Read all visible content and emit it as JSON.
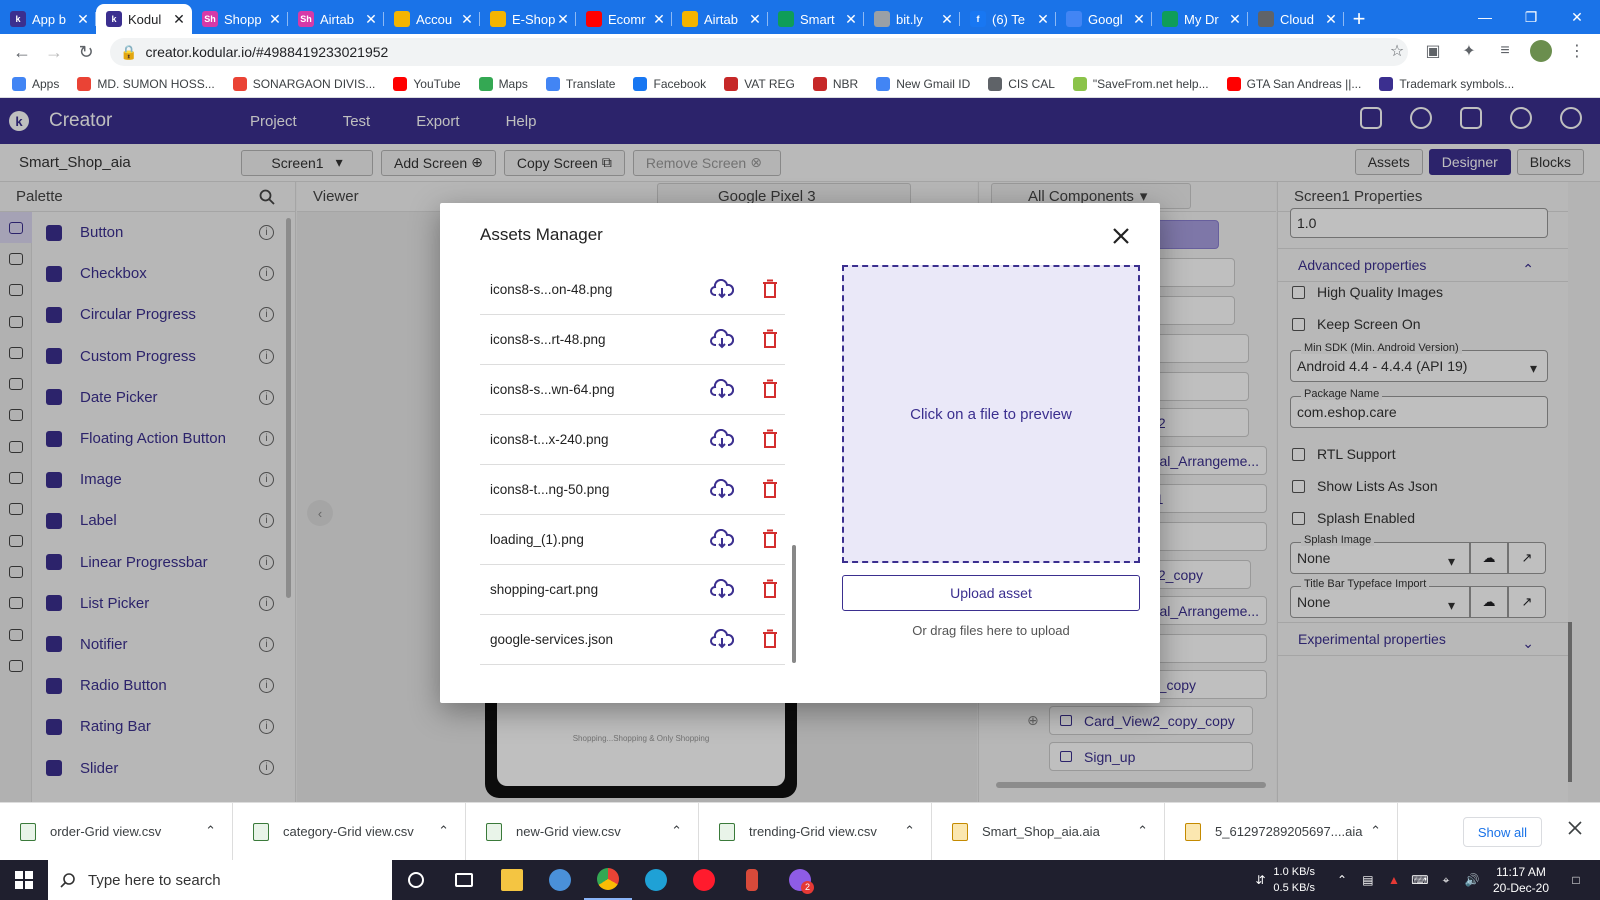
{
  "browser": {
    "tabs": [
      {
        "label": "App b",
        "color": "#3b2f8f",
        "glyph": "k"
      },
      {
        "label": "Kodul",
        "color": "#3b2f8f",
        "glyph": "k",
        "active": true
      },
      {
        "label": "Shopp",
        "color": "#d63aa8",
        "glyph": "Sh"
      },
      {
        "label": "Airtab",
        "color": "#d63aa8",
        "glyph": "Sh"
      },
      {
        "label": "Accou",
        "color": "#f4b400",
        "glyph": ""
      },
      {
        "label": "E-Shop",
        "color": "#f4b400",
        "glyph": ""
      },
      {
        "label": "Ecomr",
        "color": "#ff0000",
        "glyph": ""
      },
      {
        "label": "Airtab",
        "color": "#f4b400",
        "glyph": ""
      },
      {
        "label": "Smart",
        "color": "#0f9d58",
        "glyph": ""
      },
      {
        "label": "bit.ly",
        "color": "#9aa0a6",
        "glyph": ""
      },
      {
        "label": "(6) Te",
        "color": "#1877f2",
        "glyph": "f"
      },
      {
        "label": "Googl",
        "color": "#4285f4",
        "glyph": ""
      },
      {
        "label": "My Dr",
        "color": "#0f9d58",
        "glyph": ""
      },
      {
        "label": "Cloud",
        "color": "#5f6368",
        "glyph": ""
      }
    ],
    "new_tab": "+",
    "url": "creator.kodular.io/#4988419233021952",
    "bookmarks": [
      {
        "label": "Apps",
        "color": "#4285f4"
      },
      {
        "label": "MD. SUMON HOSS...",
        "color": "#ea4335"
      },
      {
        "label": "SONARGAON DIVIS...",
        "color": "#ea4335"
      },
      {
        "label": "YouTube",
        "color": "#ff0000"
      },
      {
        "label": "Maps",
        "color": "#34a853"
      },
      {
        "label": "Translate",
        "color": "#4285f4"
      },
      {
        "label": "Facebook",
        "color": "#1877f2"
      },
      {
        "label": "VAT REG",
        "color": "#c62828"
      },
      {
        "label": "NBR",
        "color": "#c62828"
      },
      {
        "label": "New Gmail ID",
        "color": "#4285f4"
      },
      {
        "label": "CIS CAL",
        "color": "#5f6368"
      },
      {
        "label": "\"SaveFrom.net help...",
        "color": "#8bc34a"
      },
      {
        "label": "GTA San Andreas ||...",
        "color": "#ff0000"
      },
      {
        "label": "Trademark symbols...",
        "color": "#3b2f8f"
      }
    ]
  },
  "app": {
    "title": "Creator",
    "logo": "k",
    "menu": [
      "Project",
      "Test",
      "Export",
      "Help"
    ],
    "project_name": "Smart_Shop_aia",
    "screen_select": "Screen1",
    "add_screen": "Add Screen",
    "copy_screen": "Copy Screen",
    "remove_screen": "Remove Screen",
    "view_tabs": [
      "Assets",
      "Designer",
      "Blocks"
    ],
    "accent": "#3b2f8f"
  },
  "palette": {
    "title": "Palette",
    "items": [
      "Button",
      "Checkbox",
      "Circular Progress",
      "Custom Progress",
      "Date Picker",
      "Floating Action Button",
      "Image",
      "Label",
      "Linear Progressbar",
      "List Picker",
      "Notifier",
      "Radio Button",
      "Rating Bar",
      "Slider"
    ]
  },
  "viewer": {
    "title": "Viewer",
    "device": "Google Pixel 3",
    "phone_caption": "Shopping...Shopping & Only Shopping"
  },
  "components": {
    "filter": "All Components",
    "nodes": [
      "",
      "",
      "",
      "",
      "",
      "ew2",
      "ontal_Arrangeme...",
      "ge1",
      "el2",
      "ew2_copy",
      "ontal_Arrangeme...",
      "el3",
      "el2_copy",
      "Card_View2_copy_copy",
      "Sign_up"
    ]
  },
  "properties": {
    "title": "Screen1 Properties",
    "top_value": "1.0",
    "advanced": "Advanced properties",
    "checks": [
      "High Quality Images",
      "Keep Screen On",
      "RTL Support",
      "Show Lists As Json",
      "Splash Enabled"
    ],
    "min_sdk_label": "Min SDK (Min. Android Version)",
    "min_sdk_value": "Android 4.4 - 4.4.4 (API 19)",
    "package_label": "Package Name",
    "package_value": "com.eshop.care",
    "splash_label": "Splash Image",
    "splash_value": "None",
    "titlebar_label": "Title Bar Typeface Import",
    "titlebar_value": "None",
    "experimental": "Experimental properties"
  },
  "modal": {
    "title": "Assets Manager",
    "assets": [
      "icons8-s...on-48.png",
      "icons8-s...rt-48.png",
      "icons8-s...wn-64.png",
      "icons8-t...x-240.png",
      "icons8-t...ng-50.png",
      "loading_(1).png",
      "shopping-cart.png",
      "google-services.json"
    ],
    "preview_text": "Click on a file to preview",
    "upload_label": "Upload asset",
    "drag_hint": "Or drag files here to upload",
    "delete_color": "#d32f2f"
  },
  "downloads": {
    "items": [
      {
        "label": "order-Grid view.csv",
        "type": "csv"
      },
      {
        "label": "category-Grid view.csv",
        "type": "csv"
      },
      {
        "label": "new-Grid view.csv",
        "type": "csv"
      },
      {
        "label": "trending-Grid view.csv",
        "type": "csv"
      },
      {
        "label": "Smart_Shop_aia.aia",
        "type": "zip"
      },
      {
        "label": "5_61297289205697....aia",
        "type": "zip"
      }
    ],
    "show_all": "Show all"
  },
  "taskbar": {
    "search_placeholder": "Type here to search",
    "net_up": "1.0 KB/s",
    "net_down": "0.5 KB/s",
    "time": "11:17 AM",
    "date": "20-Dec-20",
    "badge": "2"
  }
}
